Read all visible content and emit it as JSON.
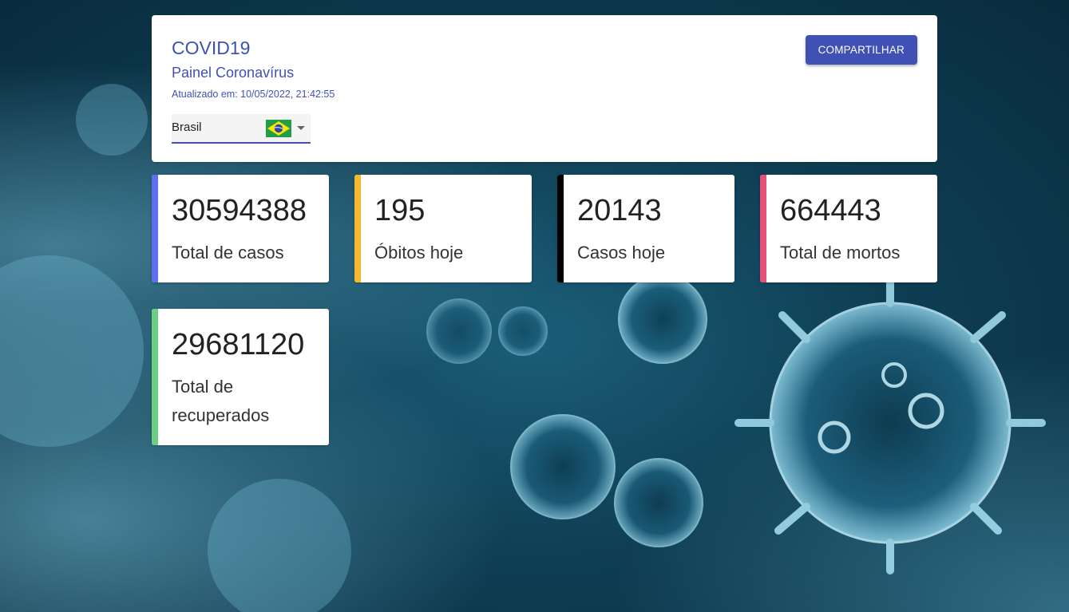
{
  "header": {
    "title": "COVID19",
    "subtitle": "Painel Coronavírus",
    "updated": "Atualizado em: 10/05/2022, 21:42:55",
    "share_label": "COMPARTILHAR"
  },
  "country_select": {
    "selected": "Brasil",
    "flag_icon": "brazil-flag-icon"
  },
  "stats": [
    {
      "value": "30594388",
      "label": "Total de casos",
      "color": "#5c6ff0"
    },
    {
      "value": "195",
      "label": "Óbitos hoje",
      "color": "#f5b82e"
    },
    {
      "value": "20143",
      "label": "Casos hoje",
      "color": "#000000"
    },
    {
      "value": "664443",
      "label": "Total de mortos",
      "color": "#e5507a"
    },
    {
      "value": "29681120",
      "label": "Total de recuperados",
      "color": "#6ccf84"
    }
  ],
  "colors": {
    "accent": "#3f51b5",
    "background": "#0f3f55"
  }
}
